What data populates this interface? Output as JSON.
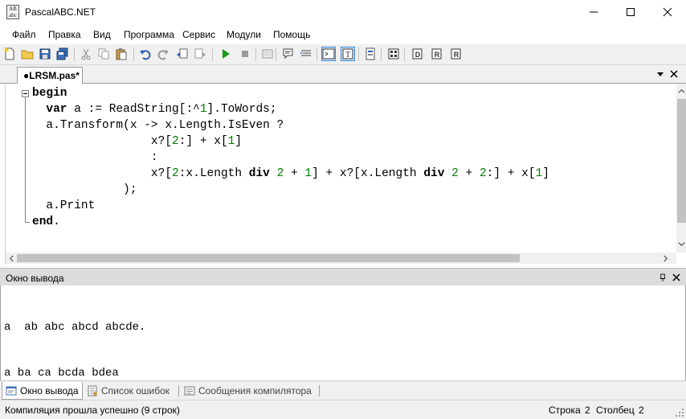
{
  "window": {
    "title": "PascalABC.NET",
    "icon_label_top": "AB",
    "icon_label_bottom": "abc"
  },
  "menu": {
    "items": [
      "Файл",
      "Правка",
      "Вид",
      "Программа",
      "Сервис",
      "Модули",
      "Помощь"
    ]
  },
  "toolbar": {
    "icons": [
      "new-file-icon",
      "open-folder-icon",
      "save-icon",
      "save-all-icon",
      "cut-icon",
      "copy-icon",
      "paste-icon",
      "undo-icon",
      "redo-icon",
      "navigate-back-icon",
      "navigate-forward-icon",
      "run-icon",
      "stop-icon",
      "comment-icon",
      "uncomment-icon",
      "console-icon",
      "text-mode-icon",
      "options-icon",
      "debug-icon",
      "step-into-icon",
      "step-over-icon",
      "step-out-icon"
    ]
  },
  "editor": {
    "tab_label": "●LRSM.pas*"
  },
  "output": {
    "panel_title": "Окно вывода",
    "lines": [
      "a  ab abc abcd abcde.",
      "a ba ca bcda bdea"
    ]
  },
  "bottom_tabs": [
    {
      "label": "Окно вывода",
      "icon": "output-window-icon",
      "active": true
    },
    {
      "label": "Список ошибок",
      "icon": "error-list-icon",
      "active": false
    },
    {
      "label": "Сообщения компилятора",
      "icon": "compiler-messages-icon",
      "active": false
    }
  ],
  "status": {
    "message": "Компиляция прошла успешно (9 строк)",
    "line_label": "Строка",
    "line_value": "2",
    "col_label": "Столбец",
    "col_value": "2"
  },
  "colors": {
    "number_literal": "#008000",
    "toggle_border": "#3a8ad8",
    "toggle_fill": "#cfe4f8",
    "run_green": "#1a9a1a"
  }
}
